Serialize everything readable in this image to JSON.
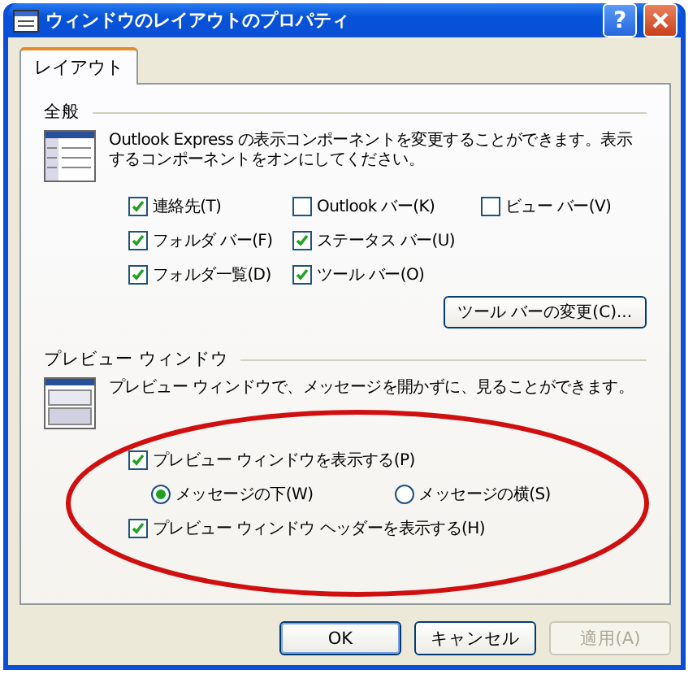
{
  "window": {
    "title": "ウィンドウのレイアウトのプロパティ",
    "help": "?"
  },
  "tabs": [
    {
      "label": "レイアウト",
      "selected": true
    }
  ],
  "general": {
    "title": "全般",
    "description": "Outlook Express の表示コンポーネントを変更することができます。表示するコンポーネントをオンにしてください。",
    "checkbox_rows": [
      [
        {
          "label": "連絡先(T)",
          "checked": true
        },
        {
          "label": "Outlook バー(K)",
          "checked": false
        },
        {
          "label": "ビュー バー(V)",
          "checked": false
        }
      ],
      [
        {
          "label": "フォルダ バー(F)",
          "checked": true
        },
        {
          "label": "ステータス バー(U)",
          "checked": true
        }
      ],
      [
        {
          "label": "フォルダ一覧(D)",
          "checked": true
        },
        {
          "label": "ツール バー(O)",
          "checked": true
        }
      ]
    ],
    "button": "ツール バーの変更(C)..."
  },
  "preview": {
    "title": "プレビュー ウィンドウ",
    "description": "プレビュー ウィンドウで、メッセージを開かずに、見ることができます。",
    "items": [
      {
        "kind": "checkbox",
        "label": "プレビュー ウィンドウを表示する(P)",
        "checked": true
      },
      {
        "kind": "radio",
        "options": [
          {
            "label": "メッセージの下(W)",
            "selected": true
          },
          {
            "label": "メッセージの横(S)",
            "selected": false
          }
        ]
      },
      {
        "kind": "checkbox",
        "label": "プレビュー ウィンドウ ヘッダーを表示する(H)",
        "checked": true
      }
    ]
  },
  "buttons": [
    {
      "label": "OK",
      "disabled": false,
      "default": true
    },
    {
      "label": "キャンセル",
      "disabled": false,
      "default": false
    },
    {
      "label": "適用(A)",
      "disabled": true,
      "default": false
    }
  ]
}
